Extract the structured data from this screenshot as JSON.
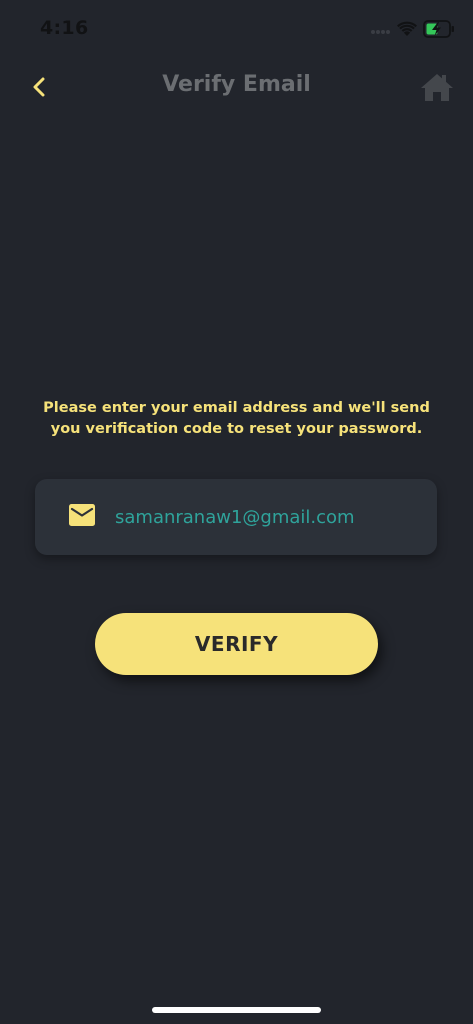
{
  "status_bar": {
    "time": "4:16"
  },
  "nav": {
    "title": "Verify Email",
    "back_icon": "chevron-left-icon",
    "home_icon": "home-icon"
  },
  "instructions": "Please enter your email address and we'll send you verification code to reset your password.",
  "email_field": {
    "icon": "mail-icon",
    "value": "samanranaw1@gmail.com"
  },
  "verify_button": {
    "label": "VERIFY"
  },
  "colors": {
    "background": "#22252c",
    "accent": "#f6e27a",
    "input_text": "#2fa39b",
    "title_text": "#6b6e72",
    "field_background": "#2c3139"
  }
}
